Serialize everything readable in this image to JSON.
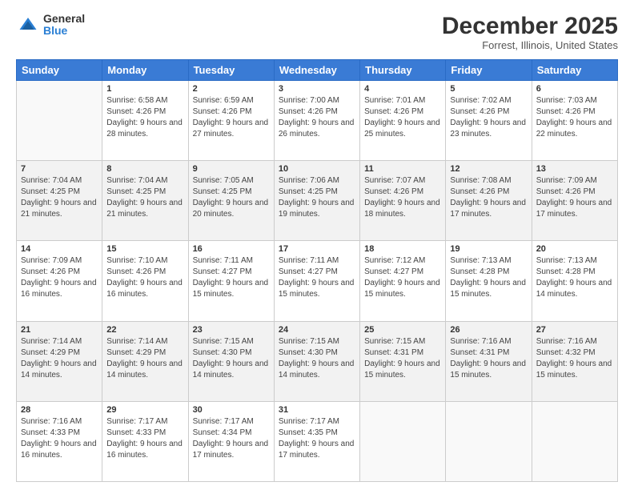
{
  "logo": {
    "general": "General",
    "blue": "Blue"
  },
  "header": {
    "month": "December 2025",
    "location": "Forrest, Illinois, United States"
  },
  "weekdays": [
    "Sunday",
    "Monday",
    "Tuesday",
    "Wednesday",
    "Thursday",
    "Friday",
    "Saturday"
  ],
  "weeks": [
    [
      {
        "day": "",
        "sunrise": "",
        "sunset": "",
        "daylight": ""
      },
      {
        "day": "1",
        "sunrise": "Sunrise: 6:58 AM",
        "sunset": "Sunset: 4:26 PM",
        "daylight": "Daylight: 9 hours and 28 minutes."
      },
      {
        "day": "2",
        "sunrise": "Sunrise: 6:59 AM",
        "sunset": "Sunset: 4:26 PM",
        "daylight": "Daylight: 9 hours and 27 minutes."
      },
      {
        "day": "3",
        "sunrise": "Sunrise: 7:00 AM",
        "sunset": "Sunset: 4:26 PM",
        "daylight": "Daylight: 9 hours and 26 minutes."
      },
      {
        "day": "4",
        "sunrise": "Sunrise: 7:01 AM",
        "sunset": "Sunset: 4:26 PM",
        "daylight": "Daylight: 9 hours and 25 minutes."
      },
      {
        "day": "5",
        "sunrise": "Sunrise: 7:02 AM",
        "sunset": "Sunset: 4:26 PM",
        "daylight": "Daylight: 9 hours and 23 minutes."
      },
      {
        "day": "6",
        "sunrise": "Sunrise: 7:03 AM",
        "sunset": "Sunset: 4:26 PM",
        "daylight": "Daylight: 9 hours and 22 minutes."
      }
    ],
    [
      {
        "day": "7",
        "sunrise": "Sunrise: 7:04 AM",
        "sunset": "Sunset: 4:25 PM",
        "daylight": "Daylight: 9 hours and 21 minutes."
      },
      {
        "day": "8",
        "sunrise": "Sunrise: 7:04 AM",
        "sunset": "Sunset: 4:25 PM",
        "daylight": "Daylight: 9 hours and 21 minutes."
      },
      {
        "day": "9",
        "sunrise": "Sunrise: 7:05 AM",
        "sunset": "Sunset: 4:25 PM",
        "daylight": "Daylight: 9 hours and 20 minutes."
      },
      {
        "day": "10",
        "sunrise": "Sunrise: 7:06 AM",
        "sunset": "Sunset: 4:25 PM",
        "daylight": "Daylight: 9 hours and 19 minutes."
      },
      {
        "day": "11",
        "sunrise": "Sunrise: 7:07 AM",
        "sunset": "Sunset: 4:26 PM",
        "daylight": "Daylight: 9 hours and 18 minutes."
      },
      {
        "day": "12",
        "sunrise": "Sunrise: 7:08 AM",
        "sunset": "Sunset: 4:26 PM",
        "daylight": "Daylight: 9 hours and 17 minutes."
      },
      {
        "day": "13",
        "sunrise": "Sunrise: 7:09 AM",
        "sunset": "Sunset: 4:26 PM",
        "daylight": "Daylight: 9 hours and 17 minutes."
      }
    ],
    [
      {
        "day": "14",
        "sunrise": "Sunrise: 7:09 AM",
        "sunset": "Sunset: 4:26 PM",
        "daylight": "Daylight: 9 hours and 16 minutes."
      },
      {
        "day": "15",
        "sunrise": "Sunrise: 7:10 AM",
        "sunset": "Sunset: 4:26 PM",
        "daylight": "Daylight: 9 hours and 16 minutes."
      },
      {
        "day": "16",
        "sunrise": "Sunrise: 7:11 AM",
        "sunset": "Sunset: 4:27 PM",
        "daylight": "Daylight: 9 hours and 15 minutes."
      },
      {
        "day": "17",
        "sunrise": "Sunrise: 7:11 AM",
        "sunset": "Sunset: 4:27 PM",
        "daylight": "Daylight: 9 hours and 15 minutes."
      },
      {
        "day": "18",
        "sunrise": "Sunrise: 7:12 AM",
        "sunset": "Sunset: 4:27 PM",
        "daylight": "Daylight: 9 hours and 15 minutes."
      },
      {
        "day": "19",
        "sunrise": "Sunrise: 7:13 AM",
        "sunset": "Sunset: 4:28 PM",
        "daylight": "Daylight: 9 hours and 15 minutes."
      },
      {
        "day": "20",
        "sunrise": "Sunrise: 7:13 AM",
        "sunset": "Sunset: 4:28 PM",
        "daylight": "Daylight: 9 hours and 14 minutes."
      }
    ],
    [
      {
        "day": "21",
        "sunrise": "Sunrise: 7:14 AM",
        "sunset": "Sunset: 4:29 PM",
        "daylight": "Daylight: 9 hours and 14 minutes."
      },
      {
        "day": "22",
        "sunrise": "Sunrise: 7:14 AM",
        "sunset": "Sunset: 4:29 PM",
        "daylight": "Daylight: 9 hours and 14 minutes."
      },
      {
        "day": "23",
        "sunrise": "Sunrise: 7:15 AM",
        "sunset": "Sunset: 4:30 PM",
        "daylight": "Daylight: 9 hours and 14 minutes."
      },
      {
        "day": "24",
        "sunrise": "Sunrise: 7:15 AM",
        "sunset": "Sunset: 4:30 PM",
        "daylight": "Daylight: 9 hours and 14 minutes."
      },
      {
        "day": "25",
        "sunrise": "Sunrise: 7:15 AM",
        "sunset": "Sunset: 4:31 PM",
        "daylight": "Daylight: 9 hours and 15 minutes."
      },
      {
        "day": "26",
        "sunrise": "Sunrise: 7:16 AM",
        "sunset": "Sunset: 4:31 PM",
        "daylight": "Daylight: 9 hours and 15 minutes."
      },
      {
        "day": "27",
        "sunrise": "Sunrise: 7:16 AM",
        "sunset": "Sunset: 4:32 PM",
        "daylight": "Daylight: 9 hours and 15 minutes."
      }
    ],
    [
      {
        "day": "28",
        "sunrise": "Sunrise: 7:16 AM",
        "sunset": "Sunset: 4:33 PM",
        "daylight": "Daylight: 9 hours and 16 minutes."
      },
      {
        "day": "29",
        "sunrise": "Sunrise: 7:17 AM",
        "sunset": "Sunset: 4:33 PM",
        "daylight": "Daylight: 9 hours and 16 minutes."
      },
      {
        "day": "30",
        "sunrise": "Sunrise: 7:17 AM",
        "sunset": "Sunset: 4:34 PM",
        "daylight": "Daylight: 9 hours and 17 minutes."
      },
      {
        "day": "31",
        "sunrise": "Sunrise: 7:17 AM",
        "sunset": "Sunset: 4:35 PM",
        "daylight": "Daylight: 9 hours and 17 minutes."
      },
      {
        "day": "",
        "sunrise": "",
        "sunset": "",
        "daylight": ""
      },
      {
        "day": "",
        "sunrise": "",
        "sunset": "",
        "daylight": ""
      },
      {
        "day": "",
        "sunrise": "",
        "sunset": "",
        "daylight": ""
      }
    ]
  ]
}
